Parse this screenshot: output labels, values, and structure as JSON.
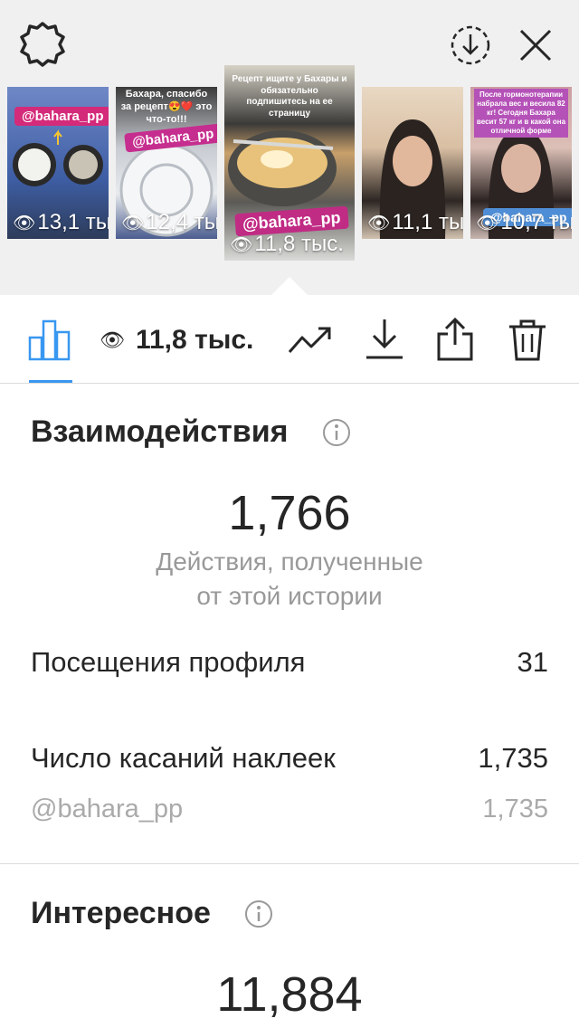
{
  "header": {
    "settings_icon": "gear-icon",
    "download_icon": "download-circle-icon",
    "close_icon": "close-icon"
  },
  "stories": [
    {
      "views": "13,1 ты",
      "tag": "@bahara_pp",
      "caption": ""
    },
    {
      "views": "12,4 ты",
      "tag": "@bahara_pp",
      "caption": "Бахара, спасибо за рецепт😍❤️ это что-то!!!"
    },
    {
      "views": "11,8 тыс.",
      "tag": "@bahara_pp",
      "caption": "Рецепт ищите у Бахары и обязательно подпишитесь на ее страницу"
    },
    {
      "views": "11,1 ты",
      "tag": "",
      "caption": ""
    },
    {
      "views": "10,7 ты",
      "tag": "@bahara_pp",
      "caption": "После гормонотерапии набрала вес и весила 82 кг! Сегодня Бахара весит 57 кг и в какой она отличной форме"
    }
  ],
  "toolbar": {
    "views_count": "11,8 тыс.",
    "accent_color": "#3897f0"
  },
  "interactions": {
    "title": "Взаимодействия",
    "total": "1,766",
    "subtitle_line1": "Действия, полученные",
    "subtitle_line2": "от этой истории",
    "profile_visits_label": "Посещения профиля",
    "profile_visits_value": "31",
    "sticker_taps_label": "Число касаний наклеек",
    "sticker_taps_value": "1,735",
    "sticker_handle": "@bahara_pp",
    "sticker_handle_value": "1,735"
  },
  "discovery": {
    "title": "Интересное",
    "total": "11,884"
  }
}
